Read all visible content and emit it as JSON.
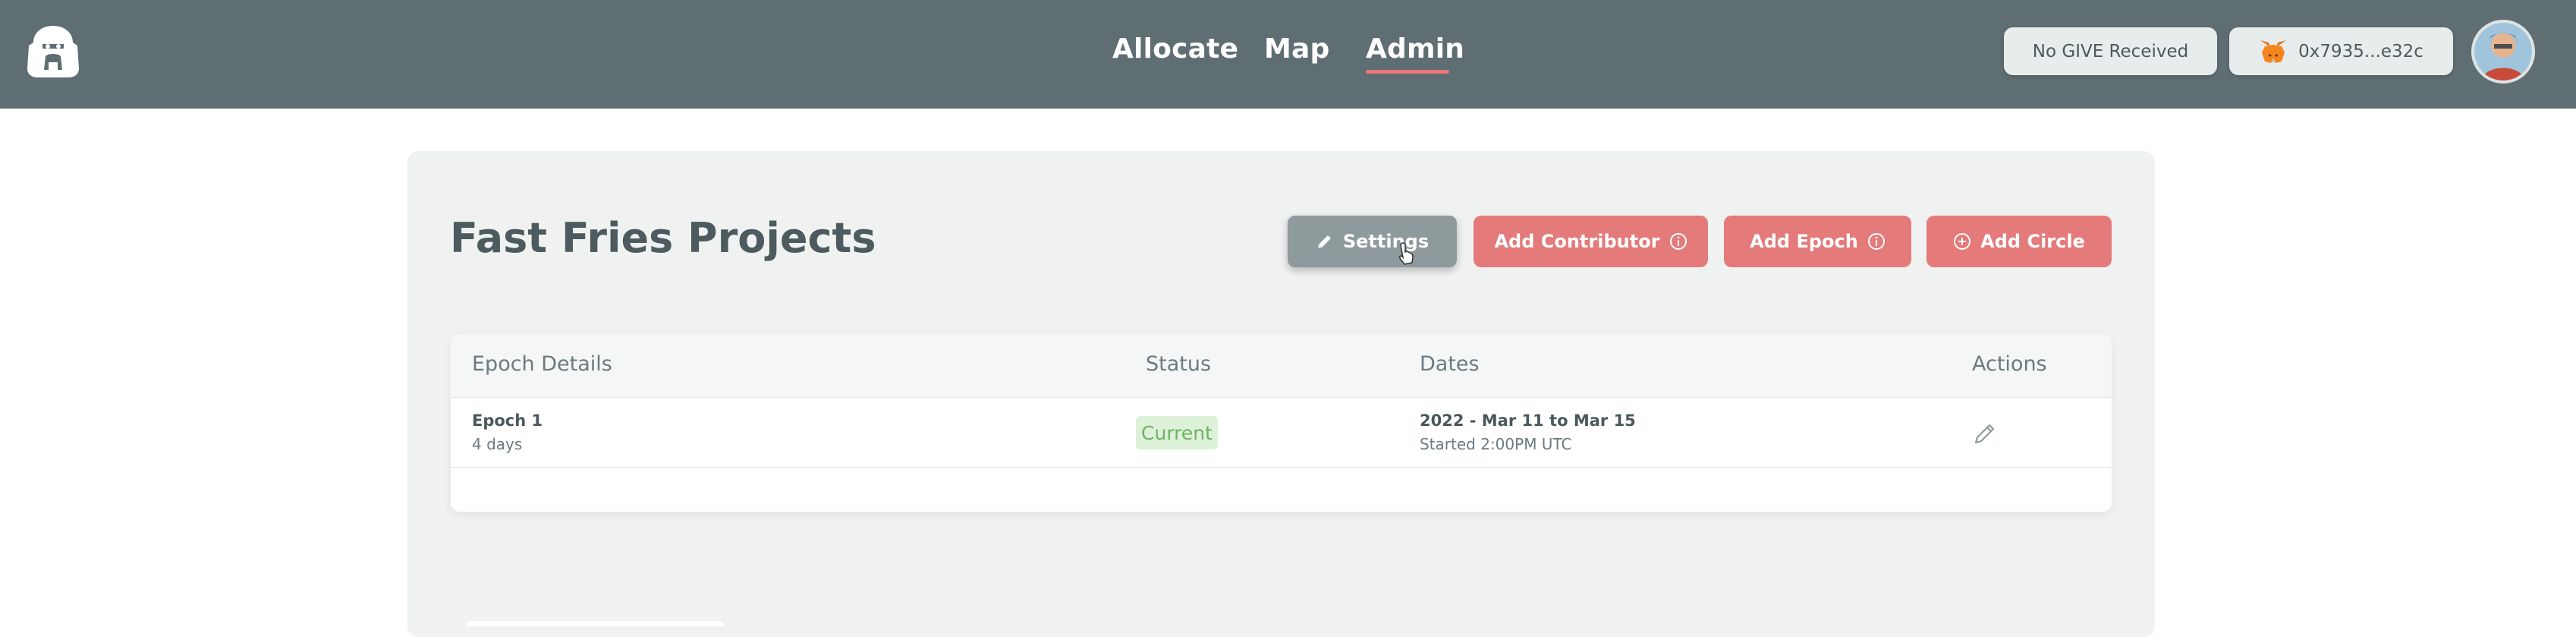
{
  "nav": {
    "items": [
      "Allocate",
      "Map",
      "Admin"
    ],
    "active": "Admin"
  },
  "header": {
    "give_status": "No GIVE Received",
    "wallet_address": "0x7935...e32c"
  },
  "page": {
    "title": "Fast Fries Projects"
  },
  "actions": {
    "settings": "Settings",
    "add_contributor": "Add Contributor",
    "add_epoch": "Add Epoch",
    "add_circle": "Add Circle"
  },
  "table": {
    "headers": {
      "details": "Epoch Details",
      "status": "Status",
      "dates": "Dates",
      "actions": "Actions"
    },
    "rows": [
      {
        "name": "Epoch 1",
        "duration": "4 days",
        "status": "Current",
        "dates": "2022 - Mar 11 to Mar 15",
        "started": "Started 2:00PM UTC"
      }
    ]
  },
  "colors": {
    "topbar": "#5f6e72",
    "accent": "#e47a7a",
    "settings_button": "#8e9a9c",
    "status_current": "#6fb264"
  },
  "icons": [
    "gorilla-logo-icon",
    "metamask-fox-icon",
    "pencil-icon",
    "info-icon",
    "plus-circle-icon",
    "edit-pencil-icon"
  ]
}
